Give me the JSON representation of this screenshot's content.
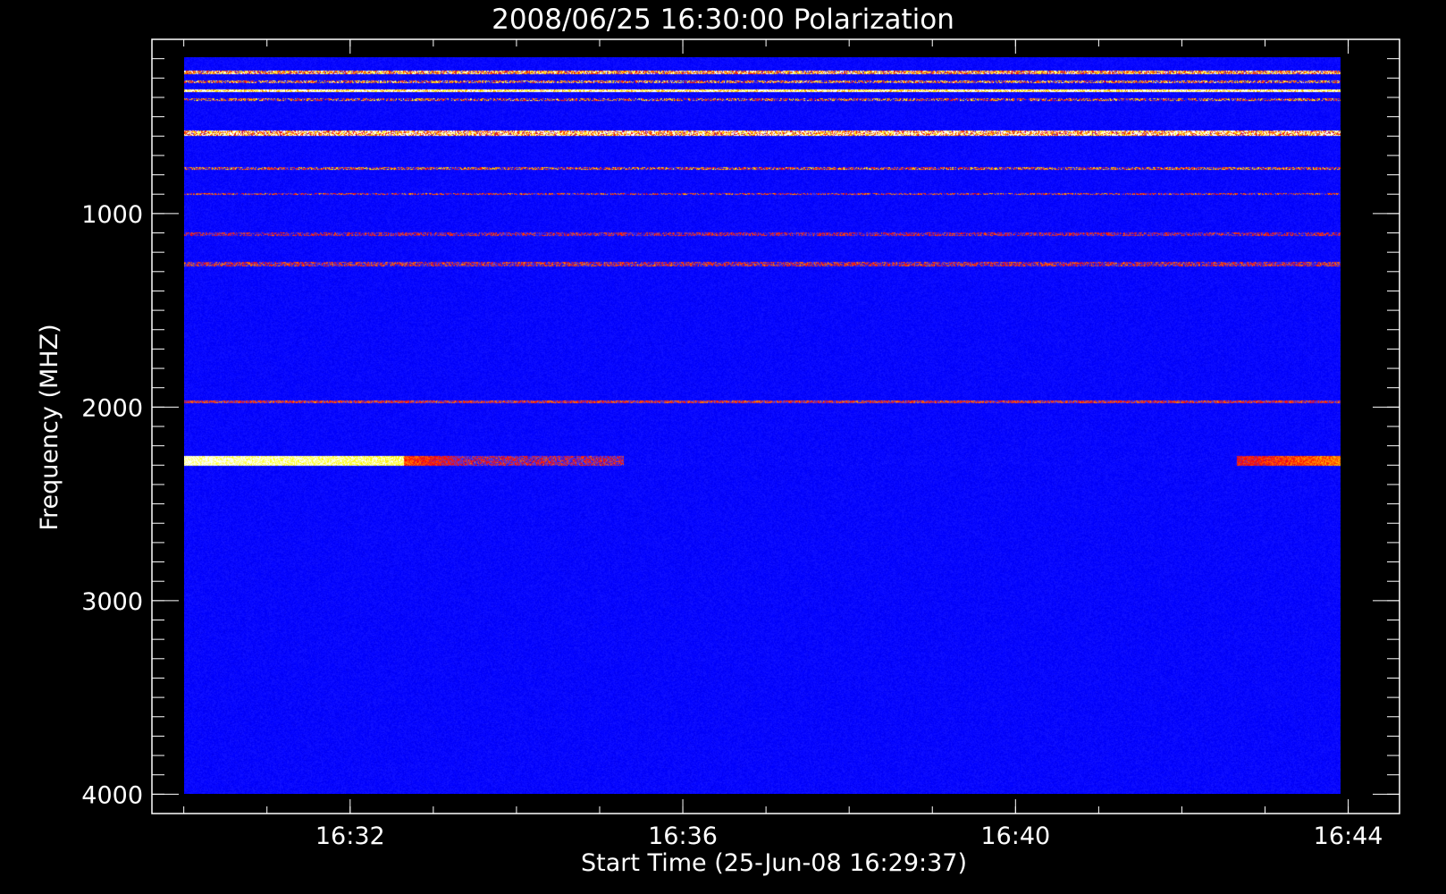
{
  "chart_data": {
    "type": "heatmap",
    "title": "2008/06/25 16:30:00 Polarization",
    "xlabel": "Start Time (25-Jun-08 16:29:37)",
    "ylabel": "Frequency (MHZ)",
    "x_tick_labels": [
      "16:32",
      "16:36",
      "16:40",
      "16:44"
    ],
    "x_ticks_minutes": [
      2.383,
      6.383,
      10.383,
      14.383
    ],
    "y_tick_labels": [
      "1000",
      "2000",
      "3000",
      "4000"
    ],
    "y_ticks": [
      1000,
      2000,
      3000,
      4000
    ],
    "xlim_minutes": [
      0,
      15.0
    ],
    "data_extent_minutes": [
      0.383,
      15.383
    ],
    "ylim": [
      100,
      4100
    ],
    "data_extent_y": [
      0,
      4000
    ],
    "y_reversed": true,
    "background_level": 0.3,
    "colors": {
      "background": "#000000",
      "frame": "#ffffff",
      "colormap": [
        "#000000",
        "#1a0060",
        "#0000ff",
        "#4040ff",
        "#ff0000",
        "#ff8000",
        "#ffff00",
        "#ffffff"
      ]
    },
    "bands": [
      {
        "freq": 80,
        "width": 15,
        "level": 0.75,
        "profile": "flat",
        "speckle": 0.35
      },
      {
        "freq": 130,
        "width": 15,
        "level": 0.6,
        "profile": "flat",
        "speckle": 0.4
      },
      {
        "freq": 180,
        "width": 18,
        "level": 0.95,
        "profile": "flat",
        "speckle": 0.25
      },
      {
        "freq": 230,
        "width": 15,
        "level": 0.5,
        "profile": "flat",
        "speckle": 0.45
      },
      {
        "freq": 410,
        "width": 25,
        "level": 0.85,
        "profile": "flat",
        "speckle": 0.4
      },
      {
        "freq": 600,
        "width": 15,
        "level": 0.55,
        "profile": "flat",
        "speckle": 0.35
      },
      {
        "freq": 740,
        "width": 12,
        "level": 0.5,
        "profile": "flat",
        "speckle": 0.3
      },
      {
        "freq": 960,
        "width": 20,
        "level": 0.45,
        "profile": "flat",
        "speckle": 0.25
      },
      {
        "freq": 1120,
        "width": 25,
        "level": 0.5,
        "profile": "flat",
        "speckle": 0.25
      },
      {
        "freq": 1870,
        "width": 15,
        "level": 0.55,
        "profile": "flat",
        "speckle": 0.2
      },
      {
        "freq": 2190,
        "width": 55,
        "level": 0.92,
        "profile": "edges",
        "speckle": 0.1
      }
    ]
  }
}
